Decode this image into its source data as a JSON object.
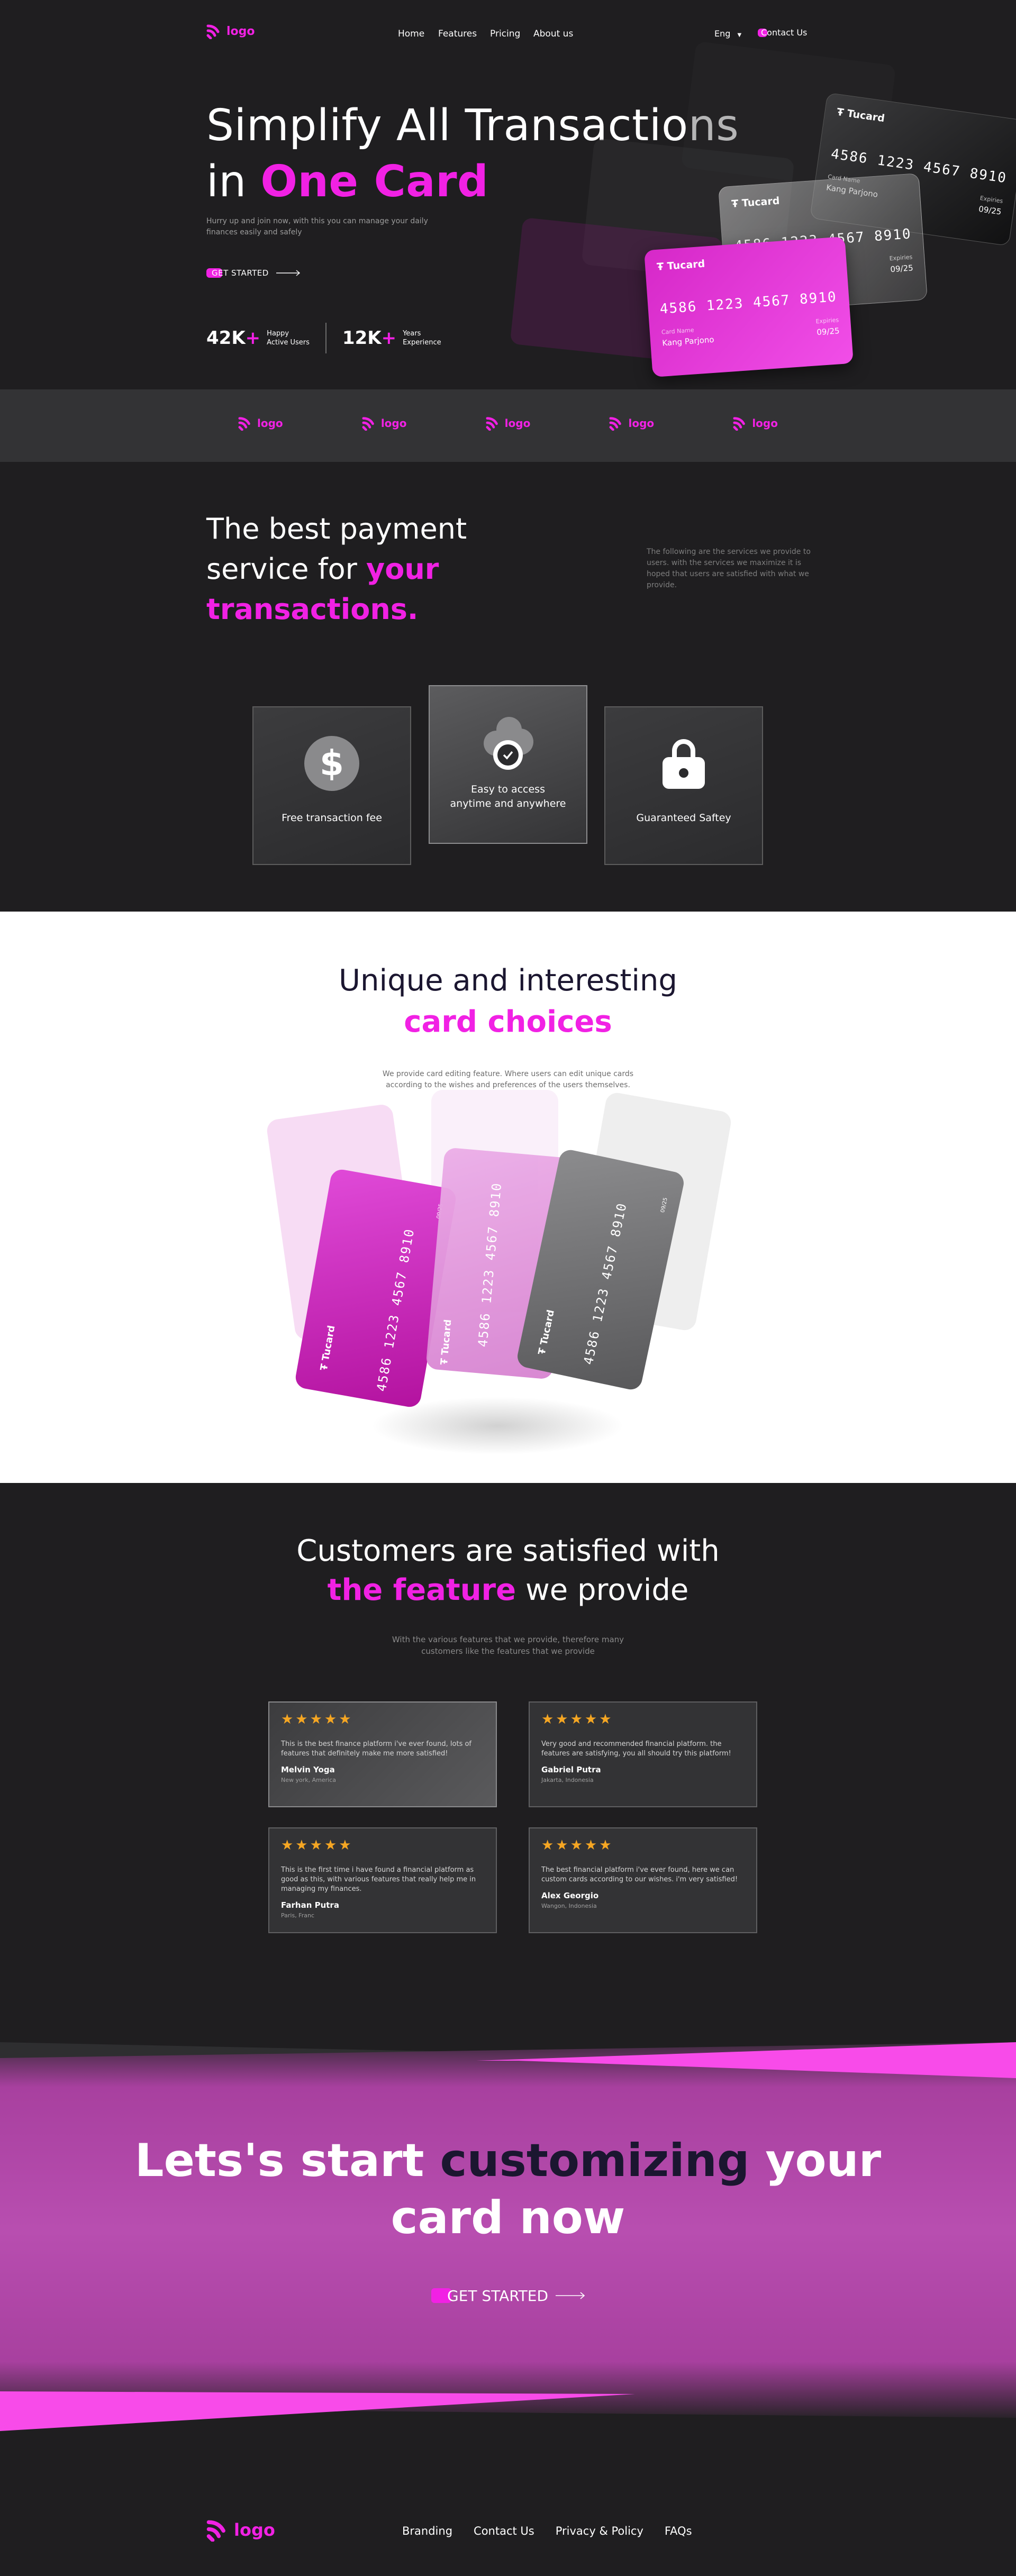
{
  "nav": {
    "logo_text": "logo",
    "links": [
      "Home",
      "Features",
      "Pricing",
      "About us"
    ],
    "language": "Eng",
    "contact_label": "Contact Us"
  },
  "hero": {
    "title_line1": "Simplify All Transactions",
    "title_line2_prefix": "in ",
    "title_line2_highlight": "One Card",
    "subtitle": "Hurry up and join now, with this you can manage your daily finances easily and safely",
    "cta_label": "GET STARTED",
    "stats": [
      {
        "value": "42K",
        "plus": "+",
        "label_line1": "Happy",
        "label_line2": "Active Users"
      },
      {
        "value": "12K",
        "plus": "+",
        "label_line1": "Years",
        "label_line2": "Experience"
      }
    ],
    "card": {
      "brand": "Tucard",
      "number": "4586 1223 4567 8910",
      "holder_label": "Card Name",
      "holder": "Kang Parjono",
      "expiry_label": "Expiries",
      "expiry": "09/25"
    }
  },
  "partners": [
    "logo",
    "logo",
    "logo",
    "logo",
    "logo"
  ],
  "services": {
    "title_line1": "The best payment",
    "title_line2_prefix": "service for ",
    "title_line2_highlight": "your",
    "title_line3_highlight": "transactions.",
    "description": "The following are the services we provide to users. with the services we maximize it is hoped that users are satisfied with what we provide.",
    "features": [
      {
        "icon": "dollar-icon",
        "label_line1": "Free transaction fee",
        "label_line2": ""
      },
      {
        "icon": "cloud-check-icon",
        "label_line1": "Easy to access",
        "label_line2": "anytime and anywhere"
      },
      {
        "icon": "lock-icon",
        "label_line1": "Guaranteed Saftey",
        "label_line2": ""
      }
    ]
  },
  "choices": {
    "title_line1": "Unique and interesting",
    "title_line2": "card choices",
    "description": "We provide card editing feature. Where users can edit unique cards according to the wishes and preferences of the users themselves.",
    "card_brand": "Tucard",
    "card_number": "4586 1223 4567 8910",
    "card_expiry": "09/25"
  },
  "testimonials": {
    "title_line1": "Customers are satisfied with",
    "title_line2_highlight": "the feature",
    "title_line2_suffix": " we provide",
    "description": "With the various features that we provide, therefore many customers like the features that we provide",
    "stars": "★★★★★",
    "reviews": [
      {
        "text": "This is the best finance platform i've ever found, lots of features that definitely make me more satisfied!",
        "name": "Melvin Yoga",
        "location": "New york, America"
      },
      {
        "text": "Very good and recommended financial platform. the features are satisfying, you all should try this platform!",
        "name": "Gabriel Putra",
        "location": "Jakarta, Indonesia"
      },
      {
        "text": "This is the first time i have found a financial platform as good as this, with various features that really help me in managing my finances.",
        "name": "Farhan Putra",
        "location": "Paris, Franc"
      },
      {
        "text": "The best financial platform i've ever found, here we can custom cards according to our wishes. i'm very satisfied!",
        "name": "Alex Georgio",
        "location": "Wangon, Indonesia"
      }
    ]
  },
  "banner": {
    "title_part1": "Lets's start ",
    "title_part2": "customizing",
    "title_part3": " your",
    "title_line2": "card now",
    "cta_label": "GET STARTED"
  },
  "footer": {
    "logo_text": "logo",
    "links": [
      "Branding",
      "Contact Us",
      "Privacy & Policy",
      "FAQs"
    ]
  },
  "colors": {
    "accent": "#f121e4",
    "background": "#1f1e20",
    "strip": "#333335",
    "star": "#f5a623",
    "banner": "#b84eb0"
  }
}
